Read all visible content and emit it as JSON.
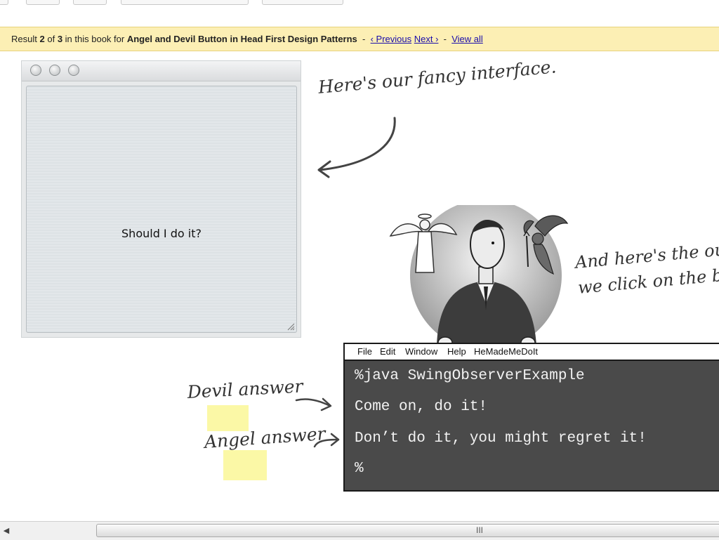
{
  "result_bar": {
    "prefix": "Result",
    "current": "2",
    "of_label": "of",
    "total": "3",
    "in_book_label": "in this book for",
    "query": "Angel and Devil Button in Head First Design Patterns",
    "sep1": "-",
    "previous_label": "‹ Previous",
    "next_label": "Next ›",
    "sep2": "-",
    "view_all_label": "View all"
  },
  "app_window": {
    "button_label": "Should I do it?"
  },
  "annotations": {
    "interface_note": "Here's our fancy interface.",
    "output_note_line1": "And here's the out",
    "output_note_line2": "we click on the bu",
    "devil_label": "Devil answer",
    "angel_label": "Angel answer"
  },
  "terminal": {
    "menu": [
      "File",
      "Edit",
      "Window",
      "Help",
      "HeMadeMeDoIt"
    ],
    "lines": [
      "%java SwingObserverExample",
      "Come on, do it!",
      "Don’t do it, you might regret it!",
      "%"
    ]
  },
  "scrollbar": {
    "left_arrow": "◀",
    "grip": "III"
  },
  "colors": {
    "result_bar_bg": "#fcefb4",
    "link": "#1a0dab",
    "terminal_bg": "#4a4a4a",
    "highlight": "#fbf8a6"
  }
}
